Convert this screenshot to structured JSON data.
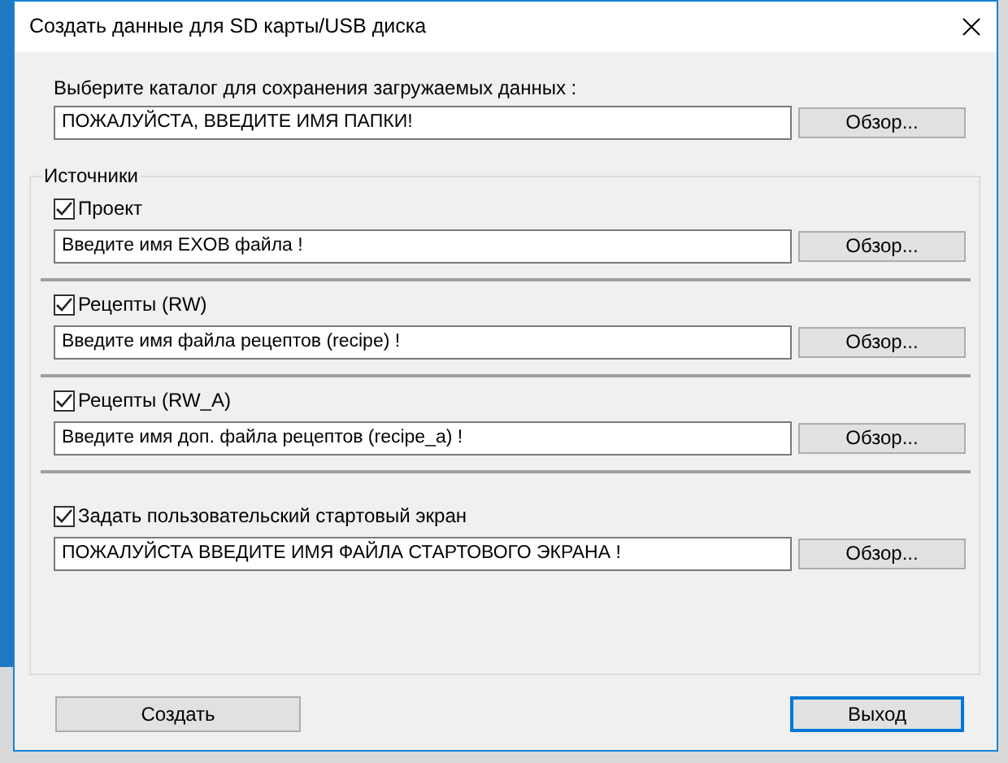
{
  "window": {
    "title": "Создать данные для SD карты/USB диска"
  },
  "target": {
    "label": "Выберите каталог для сохранения загружаемых данных :",
    "value": "ПОЖАЛУЙСТА, ВВЕДИТЕ ИМЯ ПАПКИ!",
    "browse": "Обзор..."
  },
  "sources": {
    "title": "Источники",
    "items": [
      {
        "label": "Проект",
        "checked": true,
        "value": "Введите имя EXOB файла !",
        "browse": "Обзор..."
      },
      {
        "label": "Рецепты (RW)",
        "checked": true,
        "value": "Введите имя файла рецептов (recipe) !",
        "browse": "Обзор..."
      },
      {
        "label": "Рецепты (RW_A)",
        "checked": true,
        "value": "Введите имя доп. файла рецептов (recipe_a) !",
        "browse": "Обзор..."
      },
      {
        "label": "Задать пользовательский стартовый экран",
        "checked": true,
        "value": "ПОЖАЛУЙСТА ВВЕДИТЕ ИМЯ ФАЙЛА СТАРТОВОГО ЭКРАНА !",
        "browse": "Обзор..."
      }
    ]
  },
  "buttons": [
    {
      "label": "Создать",
      "default": false
    },
    {
      "label": "Выход",
      "default": true
    }
  ]
}
